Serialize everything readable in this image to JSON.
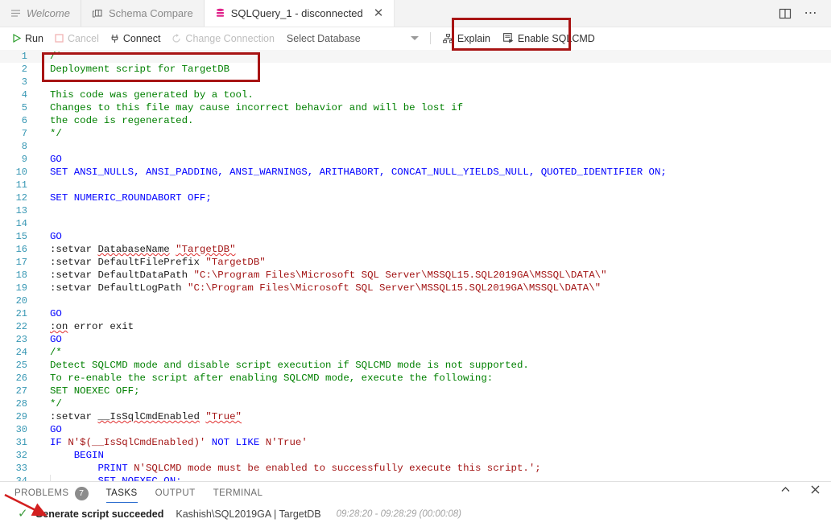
{
  "window": {
    "tabs": [
      {
        "label": "Welcome",
        "icon": "lines-icon",
        "active": false,
        "closable": false,
        "italic": true
      },
      {
        "label": "Schema Compare",
        "icon": "schema-compare-icon",
        "active": false,
        "closable": false
      },
      {
        "label": "SQLQuery_1 - disconnected",
        "icon": "database-icon",
        "active": true,
        "closable": true
      }
    ],
    "actions": [
      {
        "name": "split-editor-icon",
        "label": "Split Editor"
      },
      {
        "name": "more-actions-icon",
        "label": "..."
      }
    ]
  },
  "toolbar": {
    "run_label": "Run",
    "cancel_label": "Cancel",
    "connect_label": "Connect",
    "change_connection_label": "Change Connection",
    "database_select_value": "Select Database",
    "explain_label": "Explain",
    "enable_sqlcmd_label": "Enable SQLCMD",
    "highlight_color": "#a81414"
  },
  "editor": {
    "lines": [
      {
        "n": 1,
        "tokens": [
          {
            "t": "/*",
            "c": "cm"
          }
        ]
      },
      {
        "n": 2,
        "tokens": [
          {
            "t": "Deployment script for TargetDB",
            "c": "cm"
          }
        ]
      },
      {
        "n": 3,
        "tokens": []
      },
      {
        "n": 4,
        "tokens": [
          {
            "t": "This code was generated by a tool.",
            "c": "cm"
          }
        ]
      },
      {
        "n": 5,
        "tokens": [
          {
            "t": "Changes to this file may cause incorrect behavior and will be lost if",
            "c": "cm"
          }
        ]
      },
      {
        "n": 6,
        "tokens": [
          {
            "t": "the code is regenerated.",
            "c": "cm"
          }
        ]
      },
      {
        "n": 7,
        "tokens": [
          {
            "t": "*/",
            "c": "cm"
          }
        ]
      },
      {
        "n": 8,
        "tokens": []
      },
      {
        "n": 9,
        "tokens": [
          {
            "t": "GO",
            "c": "kw"
          }
        ]
      },
      {
        "n": 10,
        "tokens": [
          {
            "t": "SET ANSI_NULLS, ANSI_PADDING, ANSI_WARNINGS, ARITHABORT, CONCAT_NULL_YIELDS_NULL, QUOTED_IDENTIFIER ON;",
            "c": "kw"
          }
        ]
      },
      {
        "n": 11,
        "tokens": []
      },
      {
        "n": 12,
        "tokens": [
          {
            "t": "SET NUMERIC_ROUNDABORT OFF;",
            "c": "kw"
          }
        ]
      },
      {
        "n": 13,
        "tokens": []
      },
      {
        "n": 14,
        "tokens": []
      },
      {
        "n": 15,
        "tokens": [
          {
            "t": "GO",
            "c": "kw"
          }
        ]
      },
      {
        "n": 16,
        "tokens": [
          {
            "t": ":setvar ",
            "c": "pl"
          },
          {
            "t": "DatabaseName",
            "c": "pl sq"
          },
          {
            "t": " ",
            "c": "pl"
          },
          {
            "t": "\"TargetDB\"",
            "c": "str sq"
          }
        ]
      },
      {
        "n": 17,
        "tokens": [
          {
            "t": ":setvar DefaultFilePrefix ",
            "c": "pl"
          },
          {
            "t": "\"TargetDB\"",
            "c": "str"
          }
        ]
      },
      {
        "n": 18,
        "tokens": [
          {
            "t": ":setvar DefaultDataPath ",
            "c": "pl"
          },
          {
            "t": "\"C:\\Program Files\\Microsoft SQL Server\\MSSQL15.SQL2019GA\\MSSQL\\DATA\\\"",
            "c": "str"
          }
        ]
      },
      {
        "n": 19,
        "tokens": [
          {
            "t": ":setvar DefaultLogPath ",
            "c": "pl"
          },
          {
            "t": "\"C:\\Program Files\\Microsoft SQL Server\\MSSQL15.SQL2019GA\\MSSQL\\DATA\\\"",
            "c": "str"
          }
        ]
      },
      {
        "n": 20,
        "tokens": []
      },
      {
        "n": 21,
        "tokens": [
          {
            "t": "GO",
            "c": "kw"
          }
        ]
      },
      {
        "n": 22,
        "tokens": [
          {
            "t": ":on",
            "c": "pl sq"
          },
          {
            "t": " error exit",
            "c": "pl"
          }
        ]
      },
      {
        "n": 23,
        "tokens": [
          {
            "t": "GO",
            "c": "kw"
          }
        ]
      },
      {
        "n": 24,
        "tokens": [
          {
            "t": "/*",
            "c": "cm"
          }
        ]
      },
      {
        "n": 25,
        "tokens": [
          {
            "t": "Detect SQLCMD mode and disable script execution if SQLCMD mode is not supported.",
            "c": "cm"
          }
        ]
      },
      {
        "n": 26,
        "tokens": [
          {
            "t": "To re-enable the script after enabling SQLCMD mode, execute the following:",
            "c": "cm"
          }
        ]
      },
      {
        "n": 27,
        "tokens": [
          {
            "t": "SET NOEXEC OFF;",
            "c": "cm"
          }
        ]
      },
      {
        "n": 28,
        "tokens": [
          {
            "t": "*/",
            "c": "cm"
          }
        ]
      },
      {
        "n": 29,
        "tokens": [
          {
            "t": ":setvar ",
            "c": "pl"
          },
          {
            "t": "__IsSqlCmdEnabled",
            "c": "pl sq"
          },
          {
            "t": " ",
            "c": "pl"
          },
          {
            "t": "\"True\"",
            "c": "str sq"
          }
        ]
      },
      {
        "n": 30,
        "tokens": [
          {
            "t": "GO",
            "c": "kw"
          }
        ]
      },
      {
        "n": 31,
        "tokens": [
          {
            "t": "IF ",
            "c": "kw"
          },
          {
            "t": "N'$(__IsSqlCmdEnabled)'",
            "c": "str"
          },
          {
            "t": " NOT LIKE ",
            "c": "kw"
          },
          {
            "t": "N'True'",
            "c": "str"
          }
        ]
      },
      {
        "n": 32,
        "tokens": [
          {
            "t": "    BEGIN",
            "c": "kw"
          }
        ]
      },
      {
        "n": 33,
        "tokens": [
          {
            "t": "        PRINT ",
            "c": "kw"
          },
          {
            "t": "N'SQLCMD mode must be enabled to successfully execute this script.';",
            "c": "str"
          }
        ]
      },
      {
        "n": 34,
        "tokens": [
          {
            "t": "        SET NOEXEC ON;",
            "c": "kw"
          }
        ]
      }
    ]
  },
  "panel": {
    "tabs": [
      {
        "label": "PROBLEMS",
        "badge": "7",
        "active": false
      },
      {
        "label": "TASKS",
        "badge": "",
        "active": true
      },
      {
        "label": "OUTPUT",
        "badge": "",
        "active": false
      },
      {
        "label": "TERMINAL",
        "badge": "",
        "active": false
      }
    ],
    "actions": [
      {
        "name": "chevron-up-icon",
        "label": "Maximize Panel"
      },
      {
        "name": "close-icon",
        "label": "Close Panel"
      }
    ],
    "task": {
      "status_icon": "check-icon",
      "title": "Generate script succeeded",
      "target": "Kashish\\SQL2019GA | TargetDB",
      "time": "09:28:20 - 09:28:29 (00:00:08)"
    }
  },
  "annotations": {
    "comment_box_color": "#a81414",
    "sqlcmd_box_color": "#a81414",
    "arrow_color": "#d32020"
  }
}
